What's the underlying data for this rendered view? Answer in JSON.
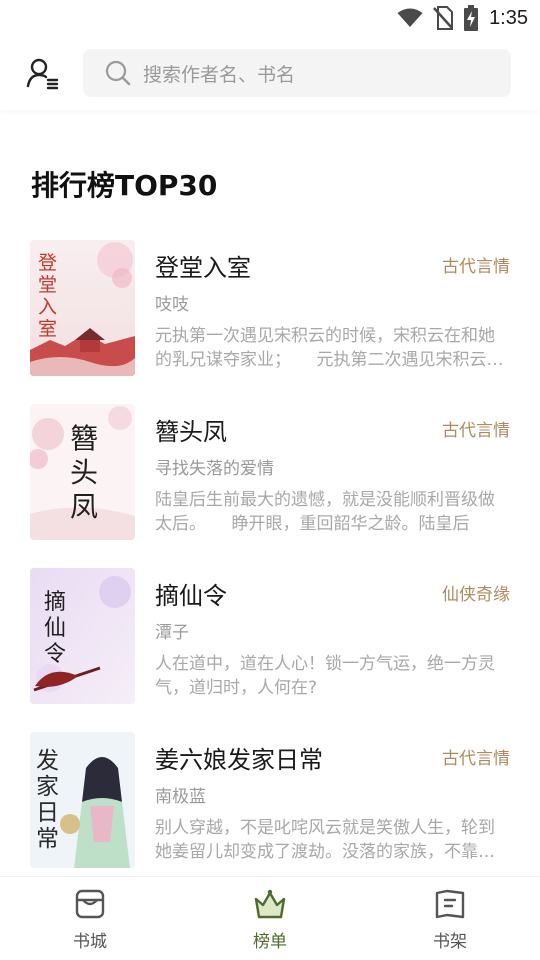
{
  "status_bar": {
    "time": "1:35",
    "icons": [
      "wifi-icon",
      "no-sim-icon",
      "battery-charging-icon"
    ]
  },
  "search": {
    "placeholder": "搜索作者名、书名"
  },
  "section_title": "排行榜TOP30",
  "books": [
    {
      "title": "登堂入室",
      "genre": "古代言情",
      "author": "吱吱",
      "description": "元执第一次遇见宋积云的时候，宋积云在和她的乳兄谋夺家业；　　元执第二次遇见宋积云的时候",
      "cover_art_text": "登堂入室"
    },
    {
      "title": "簪头凤",
      "genre": "古代言情",
      "author": "寻找失落的爱情",
      "description": "陆皇后生前最大的遗憾，就是没能顺利晋级做太后。　　睁开眼，重回韶华之龄。陆皇后",
      "cover_art_text": "簪头凤"
    },
    {
      "title": "摘仙令",
      "genre": "仙侠奇缘",
      "author": "潭子",
      "description": "人在道中，道在人心！锁一方气运，绝一方灵气，道归时，人何在?",
      "cover_art_text": "摘仙令"
    },
    {
      "title": "姜六娘发家日常",
      "genre": "古代言情",
      "author": "南极蓝",
      "description": "别人穿越，不是叱咤风云就是笑傲人生，轮到她姜留儿却变成了渡劫。没落的家族，不靠谱的",
      "cover_art_text": "发家日常"
    }
  ],
  "tabs": [
    {
      "label": "书城",
      "icon": "store-icon",
      "active": false
    },
    {
      "label": "榜单",
      "icon": "crown-icon",
      "active": true
    },
    {
      "label": "书架",
      "icon": "bookshelf-icon",
      "active": false
    }
  ],
  "colors": {
    "accent": "#4f6b2c",
    "genre": "#b18a5c"
  }
}
